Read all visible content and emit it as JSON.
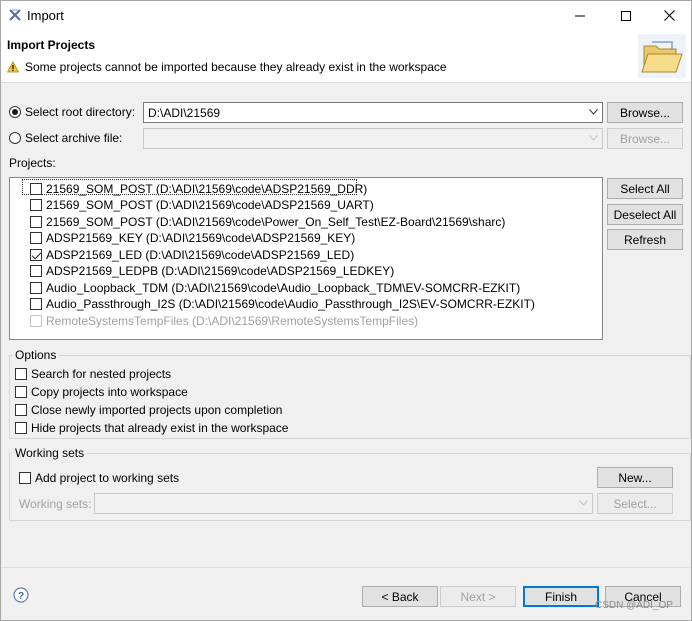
{
  "window": {
    "title": "Import",
    "controls": [
      "minimize-icon",
      "maximize-icon",
      "close-icon"
    ]
  },
  "banner": {
    "title": "Import Projects",
    "message": "Some projects cannot be imported because they already exist in the workspace",
    "message_icon": "warning-icon",
    "wizard_icon": "folder-import-icon"
  },
  "source": {
    "root_label": "Select root directory:",
    "root_value": "D:\\ADI\\21569",
    "root_selected": true,
    "archive_label": "Select archive file:",
    "archive_value": "",
    "browse_label": "Browse...",
    "browse2_label": "Browse..."
  },
  "projects": {
    "label": "Projects:",
    "items": [
      {
        "text": "21569_SOM_POST (D:\\ADI\\21569\\code\\ADSP21569_DDR)",
        "checked": false,
        "enabled": true
      },
      {
        "text": "21569_SOM_POST (D:\\ADI\\21569\\code\\ADSP21569_UART)",
        "checked": false,
        "enabled": true
      },
      {
        "text": "21569_SOM_POST (D:\\ADI\\21569\\code\\Power_On_Self_Test\\EZ-Board\\21569\\sharc)",
        "checked": false,
        "enabled": true
      },
      {
        "text": "ADSP21569_KEY (D:\\ADI\\21569\\code\\ADSP21569_KEY)",
        "checked": false,
        "enabled": true
      },
      {
        "text": "ADSP21569_LED (D:\\ADI\\21569\\code\\ADSP21569_LED)",
        "checked": true,
        "enabled": true
      },
      {
        "text": "ADSP21569_LEDPB (D:\\ADI\\21569\\code\\ADSP21569_LEDKEY)",
        "checked": false,
        "enabled": true
      },
      {
        "text": "Audio_Loopback_TDM (D:\\ADI\\21569\\code\\Audio_Loopback_TDM\\EV-SOMCRR-EZKIT)",
        "checked": false,
        "enabled": true
      },
      {
        "text": "Audio_Passthrough_I2S (D:\\ADI\\21569\\code\\Audio_Passthrough_I2S\\EV-SOMCRR-EZKIT)",
        "checked": false,
        "enabled": true
      },
      {
        "text": "RemoteSystemsTempFiles (D:\\ADI\\21569\\RemoteSystemsTempFiles)",
        "checked": false,
        "enabled": false
      }
    ],
    "select_all": "Select All",
    "deselect_all": "Deselect All",
    "refresh": "Refresh"
  },
  "options": {
    "title": "Options",
    "items": [
      {
        "text": "Search for nested projects",
        "checked": false
      },
      {
        "text": "Copy projects into workspace",
        "checked": false
      },
      {
        "text": "Close newly imported projects upon completion",
        "checked": false
      },
      {
        "text": "Hide projects that already exist in the workspace",
        "checked": false
      }
    ]
  },
  "working_sets": {
    "title": "Working sets",
    "add_label": "Add project to working sets",
    "add_checked": false,
    "new_button": "New...",
    "sets_label": "Working sets:",
    "sets_value": "",
    "select_button": "Select..."
  },
  "footer": {
    "help_icon": "help-icon",
    "back": "< Back",
    "next": "Next >",
    "finish": "Finish",
    "cancel": "Cancel"
  },
  "watermark": "CSDN @ADI_OP"
}
